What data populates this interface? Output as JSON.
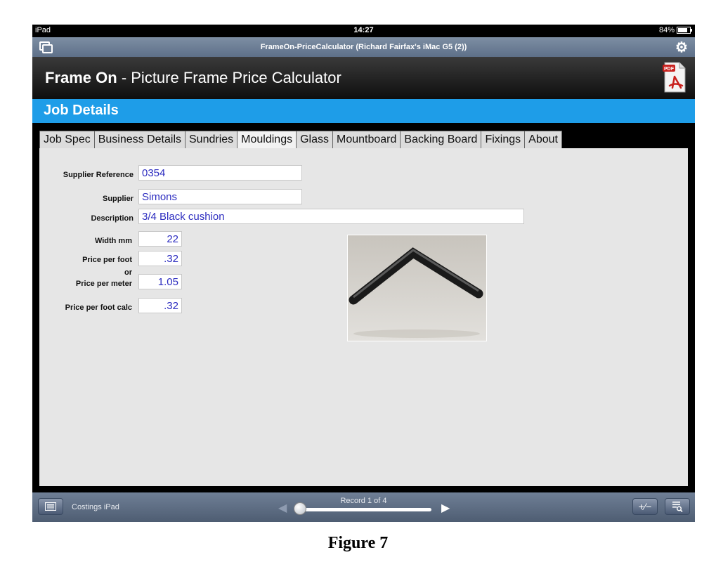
{
  "status_bar": {
    "device": "iPad",
    "time": "14:27",
    "battery": "84%"
  },
  "window": {
    "title": "FrameOn-PriceCalculator (Richard Fairfax's iMac G5 (2))"
  },
  "app_header": {
    "title_bold": "Frame On",
    "title_rest": " - Picture Frame Price Calculator",
    "pdf_icon": "pdf-icon"
  },
  "section": {
    "label": "Job Details"
  },
  "tabs": [
    {
      "label": "Job Spec"
    },
    {
      "label": "Business Details"
    },
    {
      "label": "Sundries"
    },
    {
      "label": "Mouldings",
      "active": true
    },
    {
      "label": "Glass"
    },
    {
      "label": "Mountboard"
    },
    {
      "label": "Backing Board"
    },
    {
      "label": "Fixings"
    },
    {
      "label": "About"
    }
  ],
  "form": {
    "supplier_reference": {
      "label": "Supplier Reference",
      "value": "0354"
    },
    "supplier": {
      "label": "Supplier",
      "value": "Simons"
    },
    "description": {
      "label": "Description",
      "value": "3/4 Black cushion"
    },
    "width_mm": {
      "label": "Width mm",
      "value": "22"
    },
    "price_per_foot": {
      "label": "Price per foot",
      "value": ".32"
    },
    "or_label": "or",
    "price_per_meter": {
      "label": "Price per meter",
      "value": "1.05"
    },
    "price_per_foot_calc": {
      "label": "Price per foot calc",
      "value": ".32"
    }
  },
  "bottom_bar": {
    "layout_name": "Costings iPad",
    "record_text": "Record 1 of 4",
    "record_position": 0.0
  },
  "caption": "Figure 7",
  "colors": {
    "band": "#1e9de8",
    "field_text": "#2d2dc0",
    "toolbar": "#5e7089"
  }
}
